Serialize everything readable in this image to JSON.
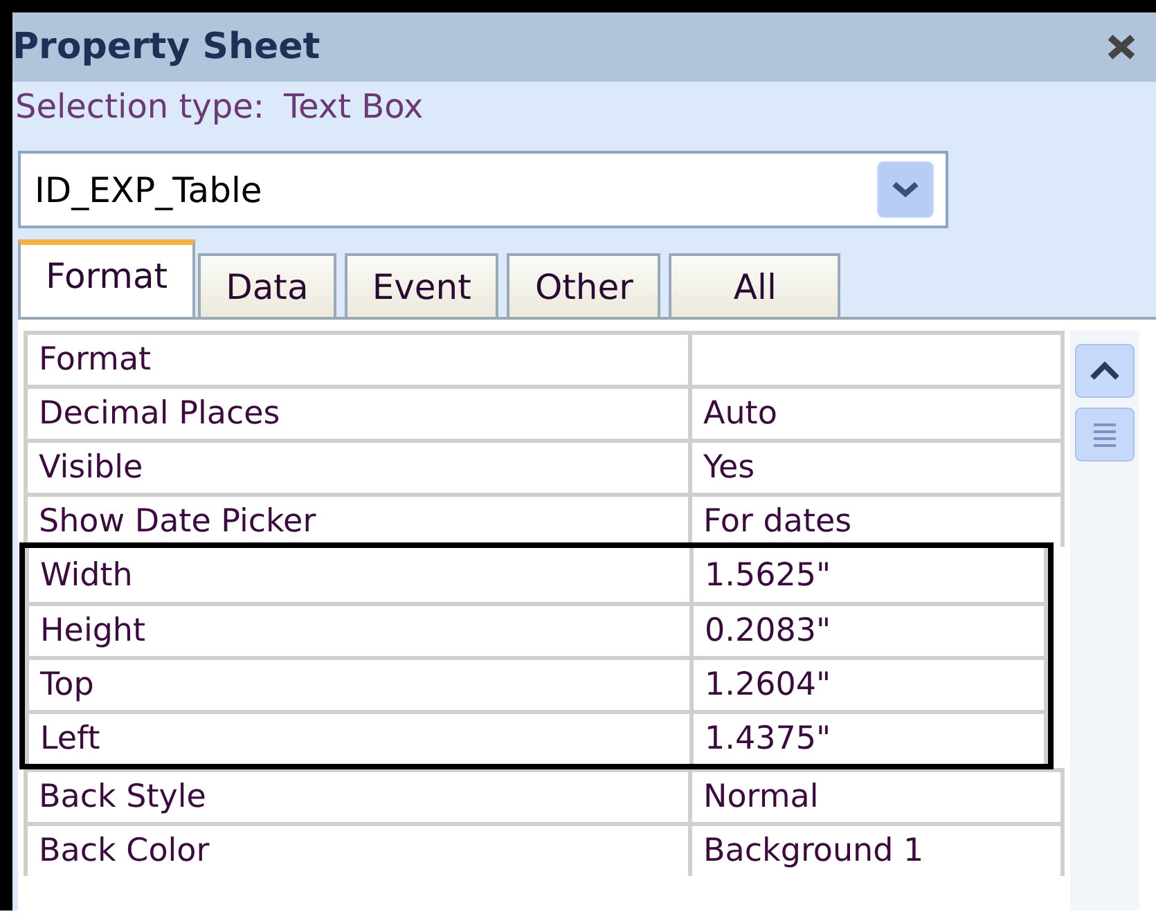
{
  "window": {
    "title": "Property Sheet"
  },
  "selection_type": {
    "label": "Selection type:",
    "value": "Text Box"
  },
  "object_combo": {
    "value": "ID_EXP_Table"
  },
  "tabs": [
    {
      "label": "Format",
      "selected": true
    },
    {
      "label": "Data",
      "selected": false
    },
    {
      "label": "Event",
      "selected": false
    },
    {
      "label": "Other",
      "selected": false
    },
    {
      "label": "All",
      "selected": false
    }
  ],
  "properties": [
    {
      "name": "Format",
      "highlighted": false
    },
    {
      "name": "Decimal Places",
      "value": "Auto",
      "highlighted": false
    },
    {
      "name": "Visible",
      "value": "Yes",
      "highlighted": false
    },
    {
      "name": "Show Date Picker",
      "value": "For dates",
      "highlighted": false
    },
    {
      "name": "Width",
      "value": "1.5625\"",
      "highlighted": true
    },
    {
      "name": "Height",
      "value": "0.2083\"",
      "highlighted": true
    },
    {
      "name": "Top",
      "value": "1.2604\"",
      "highlighted": true
    },
    {
      "name": "Left",
      "value": "1.4375\"",
      "highlighted": true
    },
    {
      "name": "Back Style",
      "value": "Normal",
      "highlighted": false
    },
    {
      "name": "Back Color",
      "value": "Background 1",
      "highlighted": false
    }
  ]
}
